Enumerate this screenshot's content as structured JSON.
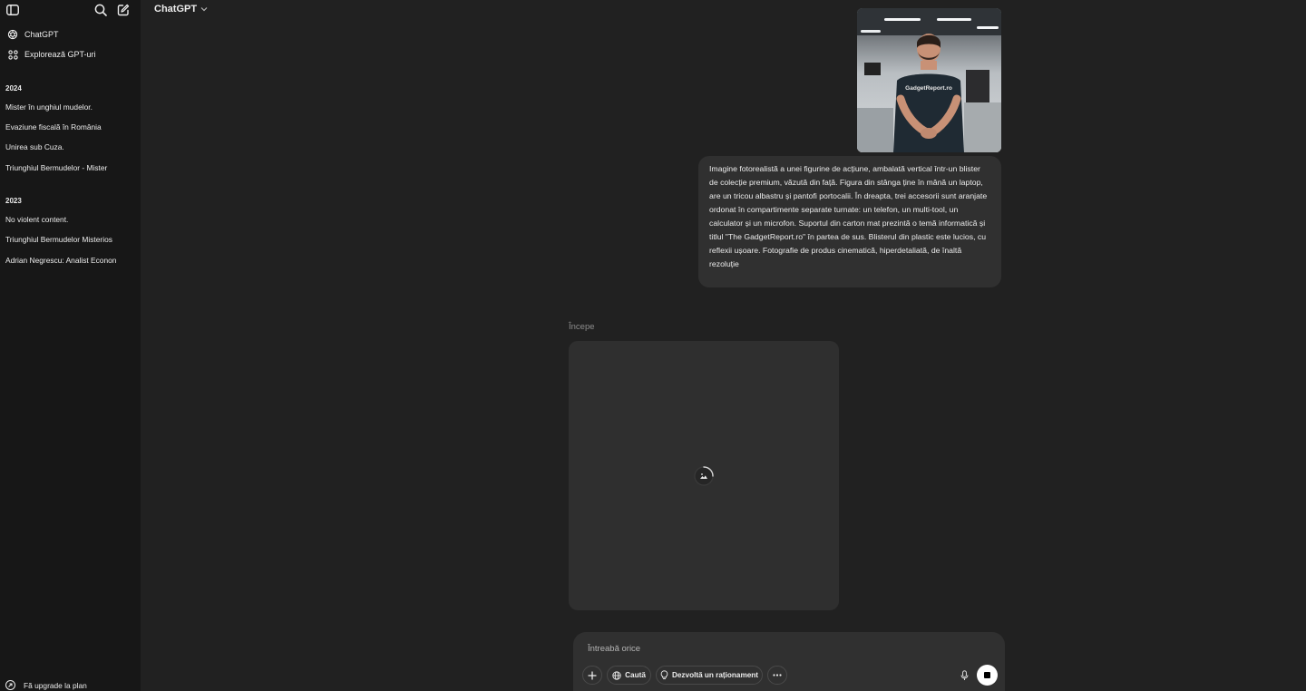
{
  "sidebar": {
    "nav": [
      {
        "label": "ChatGPT",
        "icon": "openai-logo-icon"
      },
      {
        "label": "Explorează GPT-uri",
        "icon": "grid-icon"
      }
    ],
    "sections": [
      {
        "label": "2024",
        "items": [
          "Mister în unghiul mudelor.",
          "Evaziune fiscală în România",
          "Unirea sub Cuza.",
          "Triunghiul Bermudelor - Mister"
        ]
      },
      {
        "label": "2023",
        "items": [
          "No violent content.",
          "Triunghiul Bermudelor Misterios",
          "Adrian Negrescu: Analist Econon"
        ]
      }
    ],
    "upgrade_label": "Fă upgrade la plan"
  },
  "header": {
    "model_name": "ChatGPT"
  },
  "conversation": {
    "uploaded_image_shirt_text": "GadgetReport.ro",
    "user_message": "Imagine fotorealistă a unei figurine de acțiune, ambalată vertical într-un blister de colecție premium, văzută din față. Figura din stânga ține în mână un laptop, are un tricou albastru și pantofi portocalii. În dreapta, trei accesorii sunt aranjate ordonat în compartimente separate turnate: un telefon, un multi-tool, un calculator și un microfon. Suportul din carton mat prezintă o temă informatică și titlul \"The GadgetReport.ro\" în partea de sus. Blisterul din plastic este lucios, cu reflexii ușoare. Fotografie de produs cinematică, hiperdetaliată, de înaltă rezoluție",
    "status_label": "Începe"
  },
  "composer": {
    "placeholder": "Întreabă orice",
    "search_label": "Caută",
    "reason_label": "Dezvoltă un raționament"
  },
  "colors": {
    "background": "#212121",
    "sidebar": "#171717",
    "bubble": "#303030",
    "placeholder_card": "#2f2f2f"
  }
}
